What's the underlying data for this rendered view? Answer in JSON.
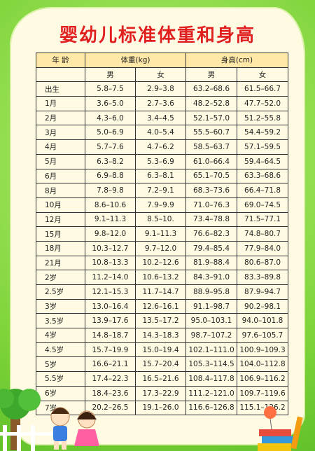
{
  "title": "婴幼儿标准体重和身高",
  "headers": {
    "age": "年 龄",
    "weight": "体重(kg)",
    "height": "身高(cm)",
    "male": "男",
    "female": "女"
  },
  "rows": [
    {
      "age": "出生",
      "w_m": "5.8–7.5",
      "w_f": "2.9–3.8",
      "h_m": "63.2–68.6",
      "h_f": "61.5–66.7"
    },
    {
      "age": "1月",
      "w_m": "3.6–5.0",
      "w_f": "2.7–3.6",
      "h_m": "48.2–52.8",
      "h_f": "47.7–52.0"
    },
    {
      "age": "2月",
      "w_m": "4.3–6.0",
      "w_f": "3.4–4.5",
      "h_m": "52.1–57.0",
      "h_f": "51.2–55.8"
    },
    {
      "age": "3月",
      "w_m": "5.0–6.9",
      "w_f": "4.0–5.4",
      "h_m": "55.5–60.7",
      "h_f": "54.4–59.2"
    },
    {
      "age": "4月",
      "w_m": "5.7–7.6",
      "w_f": "4.7–6.2",
      "h_m": "58.5–63.7",
      "h_f": "57.1–59.5"
    },
    {
      "age": "5月",
      "w_m": "6.3–8.2",
      "w_f": "5.3–6.9",
      "h_m": "61.0–66.4",
      "h_f": "59.4–64.5"
    },
    {
      "age": "6月",
      "w_m": "6.9–8.8",
      "w_f": "6.3–8.1",
      "h_m": "65.1–70.5",
      "h_f": "63.3–68.6"
    },
    {
      "age": "8月",
      "w_m": "7.8–9.8",
      "w_f": "7.2–9.1",
      "h_m": "68.3–73.6",
      "h_f": "66.4–71.8"
    },
    {
      "age": "10月",
      "w_m": "8.6–10.6",
      "w_f": "7.9–9.9",
      "h_m": "71.0–76.3",
      "h_f": "69.0–74.5"
    },
    {
      "age": "12月",
      "w_m": "9.1–11.3",
      "w_f": "8.5–10.",
      "h_m": "73.4–78.8",
      "h_f": "71.5–77.1"
    },
    {
      "age": "15月",
      "w_m": "9.8–12.0",
      "w_f": "9.1–11.3",
      "h_m": "76.6–82.3",
      "h_f": "74.8–80.7"
    },
    {
      "age": "18月",
      "w_m": "10.3–12.7",
      "w_f": "9.7–12.0",
      "h_m": "79.4–85.4",
      "h_f": "77.9–84.0"
    },
    {
      "age": "21月",
      "w_m": "10.8–13.3",
      "w_f": "10.2–12.6",
      "h_m": "81.9–88.4",
      "h_f": "80.6–87.0"
    },
    {
      "age": "2岁",
      "w_m": "11.2–14.0",
      "w_f": "10.6–13.2",
      "h_m": "84.3–91.0",
      "h_f": "83.3–89.8"
    },
    {
      "age": "2.5岁",
      "w_m": "12.1–15.3",
      "w_f": "11.7–14.7",
      "h_m": "88.9–95.8",
      "h_f": "87.9–94.7"
    },
    {
      "age": "3岁",
      "w_m": "13.0–16.4",
      "w_f": "12.6–16.1",
      "h_m": "91.1–98.7",
      "h_f": "90.2–98.1"
    },
    {
      "age": "3.5岁",
      "w_m": "13.9–17.6",
      "w_f": "13.5–17.2",
      "h_m": "95.0–103.1",
      "h_f": "94.0–101.8"
    },
    {
      "age": "4岁",
      "w_m": "14.8–18.7",
      "w_f": "14.3–18.3",
      "h_m": "98.7–107.2",
      "h_f": "97.6–105.7"
    },
    {
      "age": "4.5岁",
      "w_m": "15.7–19.9",
      "w_f": "15.0–19.4",
      "h_m": "102.1–111.0",
      "h_f": "100.9–109.3"
    },
    {
      "age": "5岁",
      "w_m": "16.6–21.1",
      "w_f": "15.7–20.4",
      "h_m": "105.3–114.5",
      "h_f": "104.0–112.8"
    },
    {
      "age": "5.5岁",
      "w_m": "17.4–22.3",
      "w_f": "16.5–21.6",
      "h_m": "108.4–117.8",
      "h_f": "106.9–116.2"
    },
    {
      "age": "6岁",
      "w_m": "18.4–23.6",
      "w_f": "17.3–22.9",
      "h_m": "111.2–121.0",
      "h_f": "109.7–119.6"
    },
    {
      "age": "7岁",
      "w_m": "20.2–26.5",
      "w_f": "19.1–26.0",
      "h_m": "116.6–126.8",
      "h_f": "115.1–126.2"
    }
  ]
}
